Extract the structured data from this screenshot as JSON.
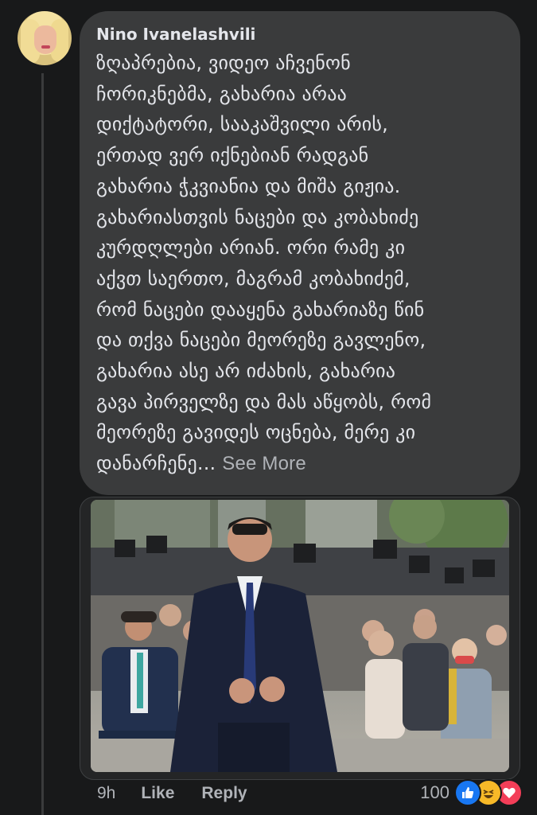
{
  "comment": {
    "author": "Nino Ivanelashvili",
    "text": "ზღაპრებია, ვიდეო აჩვენონ\nჩორიკნებმა, გახარია არაა\nდიქტატორი, სააკაშვილი არის,\nერთად ვერ იქნებიან რადგან\nგახარია ჭკვიანია და მიშა გიჟია.\nგახარიასთვის ნაცები და კობახიძე\nკურდღლები არიან. ორი რამე კი\nაქვთ საერთო, მაგრამ კობახიძემ,\nრომ ნაცები დააყენა გახარიაზე წინ\nდა თქვა ნაცები მეორეზე გავლენო,\nგახარია ასე არ  იძახის, გახარია\nგავა პირველზე და მას აწყობს, რომ\nმეორეზე გავიდეს ოცნება, მერე კი\nდანარჩენე...",
    "see_more": "See More"
  },
  "actions": {
    "time": "9h",
    "like": "Like",
    "reply": "Reply"
  },
  "reactions": {
    "count": "100",
    "icons": [
      "like-icon",
      "haha-icon",
      "love-icon"
    ]
  },
  "colors": {
    "background": "#18191a",
    "bubble": "#3a3b3c",
    "text": "#e4e6eb",
    "muted": "#b0b3b8",
    "like_blue": "#1877f2",
    "haha_yellow": "#f7b928",
    "love_red": "#f33e58"
  }
}
